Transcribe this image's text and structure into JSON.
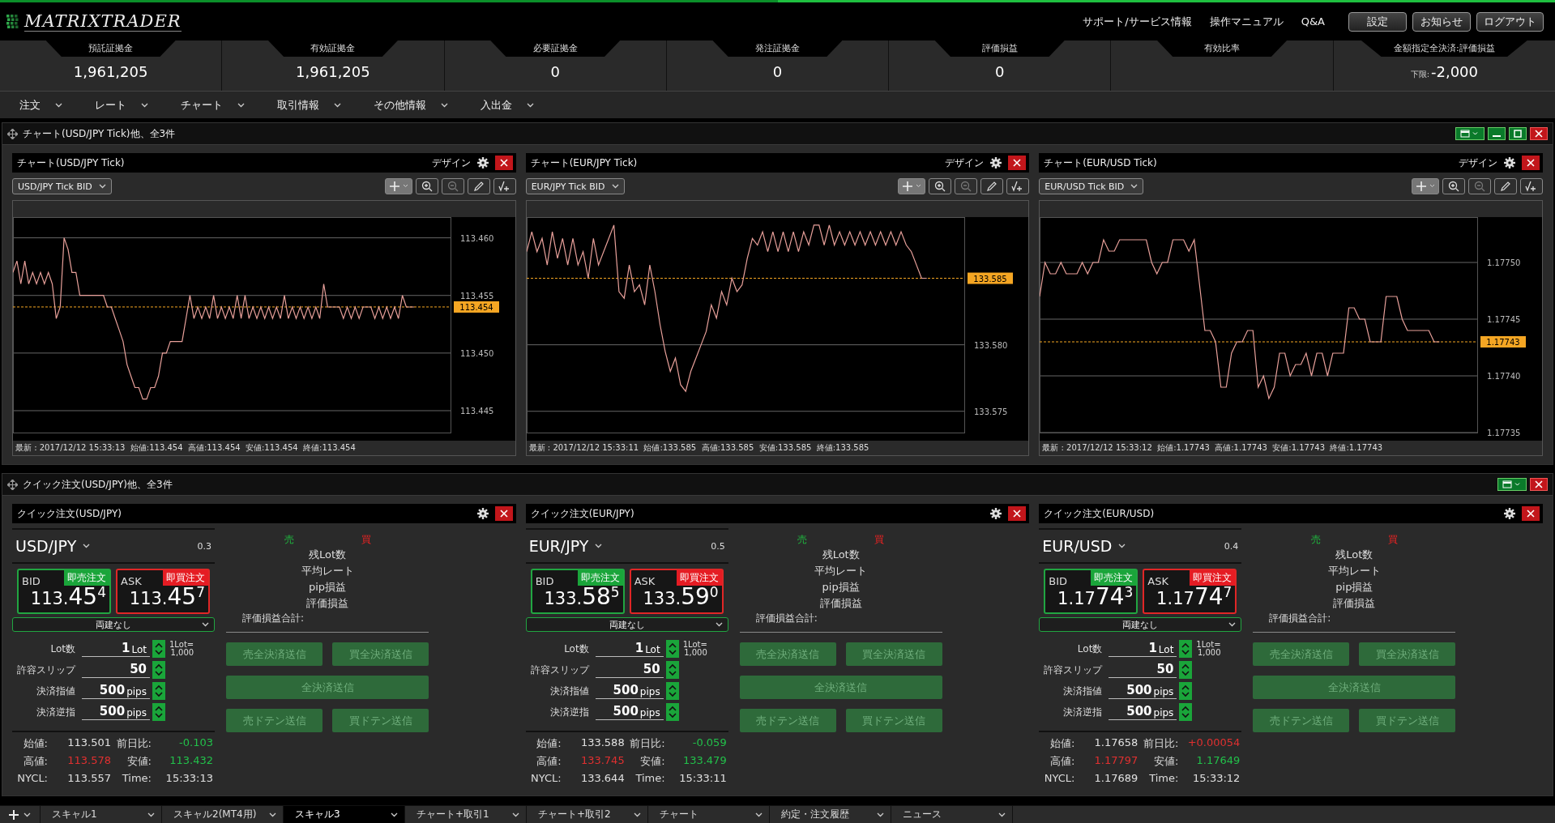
{
  "header": {
    "logo": "MATRIXTRADER",
    "links": [
      "サポート/サービス情報",
      "操作マニュアル",
      "Q&A"
    ],
    "buttons": [
      "設定",
      "お知らせ",
      "ログアウト"
    ]
  },
  "margin_summary": [
    {
      "label": "預託証拠金",
      "value": "1,961,205"
    },
    {
      "label": "有効証拠金",
      "value": "1,961,205"
    },
    {
      "label": "必要証拠金",
      "value": "0"
    },
    {
      "label": "発注証拠金",
      "value": "0"
    },
    {
      "label": "評価損益",
      "value": "0"
    },
    {
      "label": "有効比率"
    },
    {
      "label": "金額指定全決済:評価損益",
      "prefix": "下限:",
      "value": "-2,000"
    }
  ],
  "menu": [
    "注文",
    "レート",
    "チャート",
    "取引情報",
    "その他情報",
    "入出金"
  ],
  "chart_panel": {
    "title": "チャート(USD/JPY Tick)他、全3件",
    "charts": [
      {
        "title": "チャート(USD/JPY Tick)",
        "design": "デザイン",
        "footer": "最新 : 2017/12/12 15:33:13  始値:113.454  高値:113.454  安値:113.454  終値:113.454",
        "chart_data": {
          "type": "line",
          "grid": true,
          "ref_lines": [
            {
              "axis": "y",
              "value": 113.454,
              "label": "113.454",
              "color": "#f5a623"
            }
          ],
          "ylim": [
            113.4431,
            113.4618
          ],
          "yticks": [
            {
              "value": 113.445,
              "label": "113.445"
            },
            {
              "value": 113.45,
              "label": "113.450"
            },
            {
              "value": 113.455,
              "label": "113.455"
            },
            {
              "value": 113.46,
              "label": "113.460"
            }
          ],
          "series": [
            {
              "name": "USD/JPY Tick BID",
              "color": "#e8a09a",
              "values": [
                113.457,
                113.458,
                113.456,
                113.458,
                113.456,
                113.457,
                113.456,
                113.457,
                113.456,
                113.457,
                113.456,
                113.453,
                113.454,
                113.46,
                113.459,
                113.457,
                113.457,
                113.455,
                113.455,
                113.455,
                113.455,
                113.455,
                113.455,
                113.455,
                113.454,
                113.454,
                113.453,
                113.452,
                113.451,
                113.449,
                113.448,
                113.447,
                113.447,
                113.446,
                113.446,
                113.447,
                113.447,
                113.448,
                113.45,
                113.45,
                113.451,
                113.451,
                113.451,
                113.451,
                113.453,
                113.455,
                113.453,
                113.454,
                113.453,
                113.454,
                113.453,
                113.455,
                113.453,
                113.454,
                113.453,
                113.454,
                113.453,
                113.455,
                113.453,
                113.455,
                113.453,
                113.454,
                113.453,
                113.454,
                113.453,
                113.454,
                113.453,
                113.454,
                113.453,
                113.455,
                113.453,
                113.454,
                113.453,
                113.454,
                113.453,
                113.454,
                113.453,
                113.454,
                113.453,
                113.456,
                113.454,
                113.454,
                113.454,
                113.454,
                113.453,
                113.454,
                113.453,
                113.454,
                113.453,
                113.454,
                113.454,
                113.454,
                113.453,
                113.454,
                113.453,
                113.454,
                113.453,
                113.454,
                113.453,
                113.455,
                113.454,
                113.454,
                113.454
              ]
            }
          ]
        }
      },
      {
        "title": "チャート(EUR/JPY Tick)",
        "design": "デザイン",
        "footer": "最新 : 2017/12/12 15:33:11  始値:133.585  高値:133.585  安値:133.585  終値:133.585",
        "chart_data": {
          "type": "line",
          "grid": true,
          "ref_lines": [
            {
              "axis": "y",
              "value": 133.585,
              "label": "133.585",
              "color": "#f5a623"
            }
          ],
          "ylim": [
            133.5734,
            133.5896
          ],
          "yticks": [
            {
              "value": 133.575,
              "label": "133.575"
            },
            {
              "value": 133.58,
              "label": "133.580"
            }
          ],
          "series": [
            {
              "name": "EUR/JPY Tick BID",
              "color": "#e8a09a",
              "values": [
                133.587,
                133.5885,
                133.587,
                133.588,
                133.586,
                133.5885,
                133.5865,
                133.588,
                133.586,
                133.588,
                133.586,
                133.587,
                133.585,
                133.588,
                133.586,
                133.587,
                133.588,
                133.589,
                133.584,
                133.5835,
                133.586,
                133.584,
                133.5845,
                133.583,
                133.586,
                133.584,
                133.5815,
                133.5795,
                133.578,
                133.579,
                133.577,
                133.5765,
                133.578,
                133.579,
                133.58,
                133.581,
                133.583,
                133.582,
                133.584,
                133.583,
                133.585,
                133.584,
                133.5845,
                133.5865,
                133.588,
                133.5875,
                133.5885,
                133.587,
                133.5885,
                133.587,
                133.5885,
                133.587,
                133.5885,
                133.587,
                133.5885,
                133.5875,
                133.589,
                133.589,
                133.5875,
                133.589,
                133.5875,
                133.5885,
                133.5875,
                133.5885,
                133.5875,
                133.5885,
                133.5875,
                133.5885,
                133.5875,
                133.5885,
                133.5875,
                133.5885,
                133.5875,
                133.5885,
                133.5875,
                133.587,
                133.586,
                133.585,
                133.585
              ]
            }
          ]
        }
      },
      {
        "title": "チャート(EUR/USD Tick)",
        "design": "デザイン",
        "footer": "最新 : 2017/12/12 15:33:12  始値:1.17743  高値:1.17743  安値:1.17743  終値:1.17743",
        "chart_data": {
          "type": "line",
          "grid": true,
          "ref_lines": [
            {
              "axis": "y",
              "value": 1.17743,
              "label": "1.17743",
              "color": "#f5a623"
            }
          ],
          "ylim": [
            1.17735,
            1.17754
          ],
          "yticks": [
            {
              "value": 1.17735,
              "label": "1.17735"
            },
            {
              "value": 1.1774,
              "label": "1.17740"
            },
            {
              "value": 1.17745,
              "label": "1.17745"
            },
            {
              "value": 1.1775,
              "label": "1.17750"
            }
          ],
          "series": [
            {
              "name": "EUR/USD Tick BID",
              "color": "#e8a09a",
              "values": [
                1.17747,
                1.1775,
                1.17749,
                1.17749,
                1.1775,
                1.17749,
                1.17749,
                1.17749,
                1.1775,
                1.17749,
                1.1775,
                1.1775,
                1.17752,
                1.17751,
                1.17751,
                1.17752,
                1.17752,
                1.17752,
                1.17752,
                1.17752,
                1.17752,
                1.1775,
                1.17749,
                1.1775,
                1.1775,
                1.17752,
                1.17752,
                1.17752,
                1.17751,
                1.17752,
                1.17748,
                1.17744,
                1.17744,
                1.17743,
                1.17739,
                1.17739,
                1.17742,
                1.17743,
                1.17743,
                1.17744,
                1.17744,
                1.17739,
                1.1774,
                1.17738,
                1.17739,
                1.17742,
                1.17742,
                1.1774,
                1.17741,
                1.17741,
                1.17742,
                1.1774,
                1.17742,
                1.17742,
                1.1774,
                1.17742,
                1.17742,
                1.17742,
                1.17746,
                1.17746,
                1.17745,
                1.17745,
                1.17743,
                1.17743,
                1.17743,
                1.17747,
                1.17747,
                1.17747,
                1.17745,
                1.17744,
                1.17744,
                1.17744,
                1.17744,
                1.17744,
                1.17743,
                1.17743
              ]
            }
          ]
        }
      }
    ]
  },
  "quick_panel": {
    "title": "クイック注文(USD/JPY)他、全3件",
    "orders": [
      {
        "title": "クイック注文(USD/JPY)",
        "pair": "USD/JPY",
        "spread": "0.3",
        "bid": {
          "label": "BID",
          "action": "即売注文",
          "big": "113.",
          "main": "45",
          "pip": "4"
        },
        "ask": {
          "label": "ASK",
          "action": "即買注文",
          "big": "113.",
          "main": "45",
          "pip": "7"
        },
        "hedge": "両建なし",
        "fields": [
          {
            "label": "Lot数",
            "value": "1",
            "unit": "Lot"
          },
          {
            "label": "許容スリップ",
            "value": "50"
          },
          {
            "label": "決済指値",
            "value": "500",
            "unit": "pips"
          },
          {
            "label": "決済逆指",
            "value": "500",
            "unit": "pips"
          }
        ],
        "lot_note": [
          "1Lot=",
          "1,000"
        ],
        "stats": [
          {
            "label": "始値:",
            "value": "113.501",
            "color": "#e0e0e0"
          },
          {
            "label": "前日比:",
            "value": "-0.103",
            "color": "#22c04a"
          },
          {
            "label": "高値:",
            "value": "113.578",
            "color": "#e03030"
          },
          {
            "label": "安値:",
            "value": "113.432",
            "color": "#22c04a"
          },
          {
            "label": "NYCL:",
            "value": "113.557",
            "color": "#e0e0e0"
          },
          {
            "label": "Time:",
            "value": "15:33:13",
            "color": "#e0e0e0"
          }
        ],
        "sell_label": "売",
        "buy_label": "買",
        "position_rows": [
          "残Lot数",
          "平均レート",
          "pip損益",
          "評価損益"
        ],
        "total_label": "評価損益合計:",
        "buttons": [
          {
            "label": "売全決済送信",
            "kind": "half",
            "disabled": true
          },
          {
            "label": "買全決済送信",
            "kind": "half",
            "disabled": true
          },
          {
            "label": "全決済送信",
            "kind": "wide",
            "disabled": true
          },
          {
            "label": "売ドテン送信",
            "kind": "half",
            "disabled": true
          },
          {
            "label": "買ドテン送信",
            "kind": "half",
            "disabled": true
          }
        ]
      },
      {
        "title": "クイック注文(EUR/JPY)",
        "pair": "EUR/JPY",
        "spread": "0.5",
        "bid": {
          "label": "BID",
          "action": "即売注文",
          "big": "133.",
          "main": "58",
          "pip": "5"
        },
        "ask": {
          "label": "ASK",
          "action": "即買注文",
          "big": "133.",
          "main": "59",
          "pip": "0"
        },
        "hedge": "両建なし",
        "fields": [
          {
            "label": "Lot数",
            "value": "1",
            "unit": "Lot"
          },
          {
            "label": "許容スリップ",
            "value": "50"
          },
          {
            "label": "決済指値",
            "value": "500",
            "unit": "pips"
          },
          {
            "label": "決済逆指",
            "value": "500",
            "unit": "pips"
          }
        ],
        "lot_note": [
          "1Lot=",
          "1,000"
        ],
        "stats": [
          {
            "label": "始値:",
            "value": "133.588",
            "color": "#e0e0e0"
          },
          {
            "label": "前日比:",
            "value": "-0.059",
            "color": "#22c04a"
          },
          {
            "label": "高値:",
            "value": "133.745",
            "color": "#e03030"
          },
          {
            "label": "安値:",
            "value": "133.479",
            "color": "#22c04a"
          },
          {
            "label": "NYCL:",
            "value": "133.644",
            "color": "#e0e0e0"
          },
          {
            "label": "Time:",
            "value": "15:33:11",
            "color": "#e0e0e0"
          }
        ],
        "sell_label": "売",
        "buy_label": "買",
        "position_rows": [
          "残Lot数",
          "平均レート",
          "pip損益",
          "評価損益"
        ],
        "total_label": "評価損益合計:",
        "buttons": [
          {
            "label": "売全決済送信",
            "kind": "half",
            "disabled": true
          },
          {
            "label": "買全決済送信",
            "kind": "half",
            "disabled": true
          },
          {
            "label": "全決済送信",
            "kind": "wide",
            "disabled": true
          },
          {
            "label": "売ドテン送信",
            "kind": "half",
            "disabled": true
          },
          {
            "label": "買ドテン送信",
            "kind": "half",
            "disabled": true
          }
        ]
      },
      {
        "title": "クイック注文(EUR/USD)",
        "pair": "EUR/USD",
        "spread": "0.4",
        "bid": {
          "label": "BID",
          "action": "即売注文",
          "big": "1.17",
          "main": "74",
          "pip": "3"
        },
        "ask": {
          "label": "ASK",
          "action": "即買注文",
          "big": "1.17",
          "main": "74",
          "pip": "7"
        },
        "hedge": "両建なし",
        "fields": [
          {
            "label": "Lot数",
            "value": "1",
            "unit": "Lot"
          },
          {
            "label": "許容スリップ",
            "value": "50"
          },
          {
            "label": "決済指値",
            "value": "500",
            "unit": "pips"
          },
          {
            "label": "決済逆指",
            "value": "500",
            "unit": "pips"
          }
        ],
        "lot_note": [
          "1Lot=",
          "1,000"
        ],
        "stats": [
          {
            "label": "始値:",
            "value": "1.17658",
            "color": "#e0e0e0"
          },
          {
            "label": "前日比:",
            "value": "+0.00054",
            "color": "#e03030"
          },
          {
            "label": "高値:",
            "value": "1.17797",
            "color": "#e03030"
          },
          {
            "label": "安値:",
            "value": "1.17649",
            "color": "#22c04a"
          },
          {
            "label": "NYCL:",
            "value": "1.17689",
            "color": "#e0e0e0"
          },
          {
            "label": "Time:",
            "value": "15:33:12",
            "color": "#e0e0e0"
          }
        ],
        "sell_label": "売",
        "buy_label": "買",
        "position_rows": [
          "残Lot数",
          "平均レート",
          "pip損益",
          "評価損益"
        ],
        "total_label": "評価損益合計:",
        "buttons": [
          {
            "label": "売全決済送信",
            "kind": "half",
            "disabled": true
          },
          {
            "label": "買全決済送信",
            "kind": "half",
            "disabled": true
          },
          {
            "label": "全決済送信",
            "kind": "wide",
            "disabled": true
          },
          {
            "label": "売ドテン送信",
            "kind": "half",
            "disabled": true
          },
          {
            "label": "買ドテン送信",
            "kind": "half",
            "disabled": true
          }
        ]
      }
    ]
  },
  "bottom_tabs": [
    {
      "label": "スキャル1",
      "selected": false
    },
    {
      "label": "スキャル2(MT4用)",
      "selected": false
    },
    {
      "label": "スキャル3",
      "selected": true
    },
    {
      "label": "チャート+取引1",
      "selected": false
    },
    {
      "label": "チャート+取引2",
      "selected": false
    },
    {
      "label": "チャート",
      "selected": false
    },
    {
      "label": "約定・注文履歴",
      "selected": false
    },
    {
      "label": "ニュース",
      "selected": false
    }
  ]
}
